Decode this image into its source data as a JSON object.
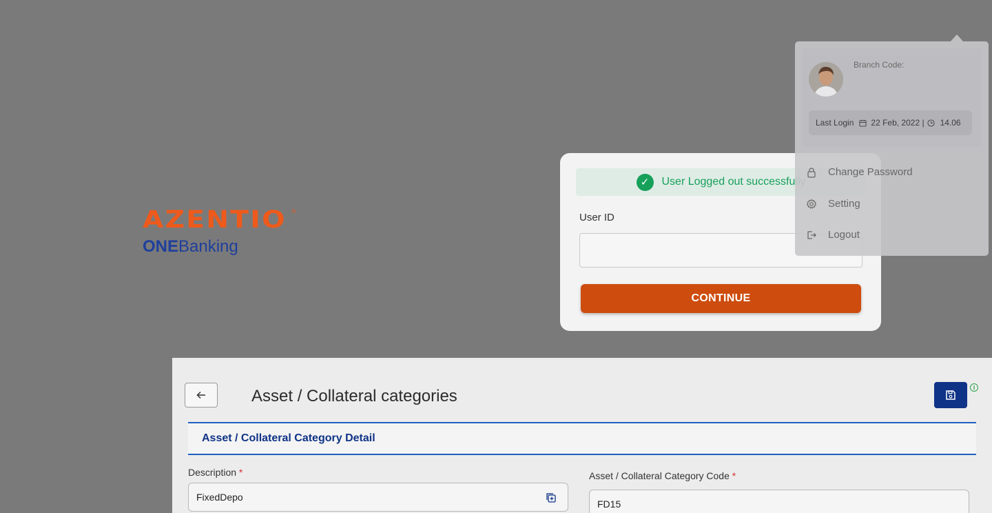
{
  "brand": {
    "logo_text": "AZENTIO",
    "tm": "®",
    "one": "ONE",
    "banking": "Banking"
  },
  "login": {
    "alert_text": "User Logged out successfully",
    "user_id_label": "User ID",
    "user_id_value": "",
    "continue_label": "CONTINUE"
  },
  "profile_menu": {
    "branch_code_label": "Branch Code:",
    "last_login_label": "Last Login",
    "last_login_date": "22 Feb, 2022 |",
    "last_login_time": "14.06",
    "items": [
      {
        "label": "Change Password",
        "icon": "lock-icon"
      },
      {
        "label": "Setting",
        "icon": "gear-icon"
      },
      {
        "label": "Logout",
        "icon": "logout-icon"
      }
    ]
  },
  "form": {
    "page_title": "Asset / Collateral categories",
    "section_title": "Asset / Collateral Category Detail",
    "description_label": "Description",
    "description_value": "FixedDepo",
    "code_label": "Asset / Collateral Category Code",
    "code_value": "FD15",
    "required_marker": "*"
  },
  "colors": {
    "backdrop": "#7a7a7a",
    "brand_orange": "#ee5a1c",
    "brand_blue": "#1f3f9c",
    "continue_button": "#cd4c0e",
    "success_green": "#17a05a",
    "primary_navy": "#0f3386",
    "tab_border": "#1f5fbf"
  }
}
